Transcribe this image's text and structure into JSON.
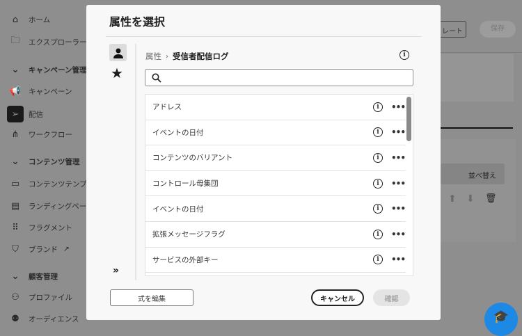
{
  "sidebar": {
    "items": [
      {
        "label": "ホーム",
        "icon": "home-icon"
      },
      {
        "label": "エクスプローラー",
        "icon": "folder-search-icon"
      },
      {
        "label": "キャンペーン管理",
        "section": true
      },
      {
        "label": "キャンペーン",
        "icon": "megaphone-icon"
      },
      {
        "label": "配信",
        "icon": "send-icon",
        "active": true
      },
      {
        "label": "ワークフロー",
        "icon": "workflow-icon"
      },
      {
        "label": "コンテンツ管理",
        "section": true
      },
      {
        "label": "コンテンツテンプ",
        "icon": "template-icon"
      },
      {
        "label": "ランディングペー",
        "icon": "landing-page-icon"
      },
      {
        "label": "フラグメント",
        "icon": "fragment-icon"
      },
      {
        "label": "ブランド",
        "icon": "brand-icon"
      },
      {
        "label": "顧客管理",
        "section": true
      },
      {
        "label": "プロファイル",
        "icon": "profile-icon"
      },
      {
        "label": "オーディエンス",
        "icon": "audience-icon"
      }
    ]
  },
  "background": {
    "template_button": "レート",
    "save_button": "保存",
    "sort_label": "並べ替え"
  },
  "modal": {
    "title": "属性を選択",
    "breadcrumb": {
      "parent": "属性",
      "current": "受信者配信ログ"
    },
    "search": {
      "value": "",
      "placeholder": ""
    },
    "attributes": [
      "アドレス",
      "イベントの日付",
      "コンテンツのバリアント",
      "コントロール母集団",
      "イベントの日付",
      "拡張メッセージフラグ",
      "サービスの外部キー"
    ],
    "edit_expression": "式を編集",
    "cancel": "キャンセル",
    "confirm": "確認",
    "expand": "»"
  },
  "colors": {
    "help_button": "#1e88e5"
  }
}
